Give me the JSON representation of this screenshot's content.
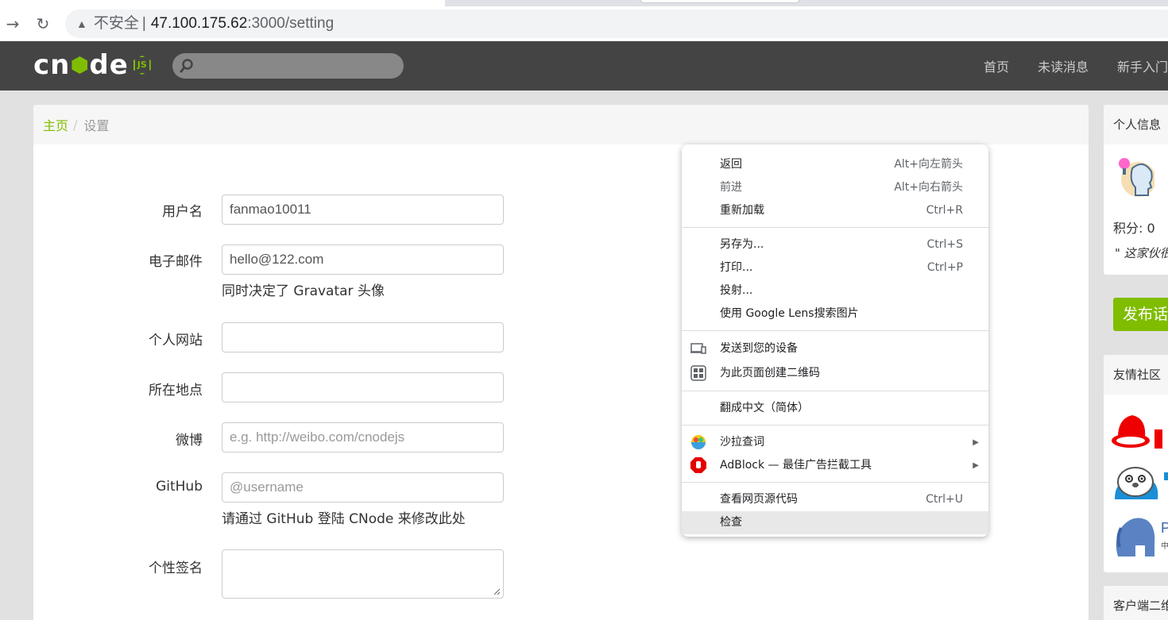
{
  "browser": {
    "insecure_label": "不安全",
    "separator": "|",
    "url_host": "47.100.175.62",
    "url_path": ":3000/setting"
  },
  "navbar": {
    "logo_text": "cnode",
    "links": [
      "首页",
      "未读消息",
      "新手入门"
    ]
  },
  "breadcrumb": {
    "home": "主页",
    "separator": "/",
    "current": "设置"
  },
  "form": {
    "username_label": "用户名",
    "username_value": "fanmao10011",
    "email_label": "电子邮件",
    "email_value": "hello@122.com",
    "email_help": "同时决定了 Gravatar 头像",
    "website_label": "个人网站",
    "location_label": "所在地点",
    "weibo_label": "微博",
    "weibo_placeholder": "e.g. http://weibo.com/cnodejs",
    "github_label": "GitHub",
    "github_placeholder": "@username",
    "github_help": "请通过 GitHub 登陆 CNode 来修改此处",
    "signature_label": "个性签名"
  },
  "sidebar": {
    "profile_title": "个人信息",
    "score": "积分: 0",
    "signature": "\" 这家伙很",
    "publish_button": "发布话题",
    "friends_title": "友情社区",
    "client_title": "客户端二维码"
  },
  "context_menu": {
    "back": "返回",
    "back_shortcut": "Alt+向左箭头",
    "forward": "前进",
    "forward_shortcut": "Alt+向右箭头",
    "reload": "重新加载",
    "reload_shortcut": "Ctrl+R",
    "save_as": "另存为...",
    "save_as_shortcut": "Ctrl+S",
    "print": "打印...",
    "print_shortcut": "Ctrl+P",
    "cast": "投射...",
    "lens": "使用 Google Lens搜索图片",
    "send_to_devices": "发送到您的设备",
    "qr_code": "为此页面创建二维码",
    "translate": "翻成中文（简体）",
    "shala": "沙拉查词",
    "adblock": "AdBlock — 最佳广告拦截工具",
    "view_source": "查看网页源代码",
    "view_source_shortcut": "Ctrl+U",
    "inspect": "检查"
  },
  "colors": {
    "brand_green": "#80bd01",
    "navbar_bg": "#444444"
  }
}
